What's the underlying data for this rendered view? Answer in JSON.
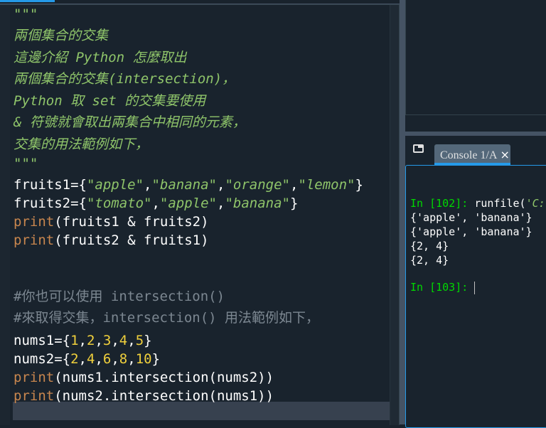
{
  "editor": {
    "lines": [
      [
        {
          "t": "\"\"\"",
          "c": "doc"
        }
      ],
      [
        {
          "t": "兩個集合的交集",
          "c": "doc"
        }
      ],
      [
        {
          "t": "這邊介紹 Python 怎麼取出",
          "c": "doc"
        }
      ],
      [
        {
          "t": "兩個集合的交集(intersection)，",
          "c": "doc"
        }
      ],
      [
        {
          "t": "Python 取 set 的交集要使用",
          "c": "doc"
        }
      ],
      [
        {
          "t": "& 符號就會取出兩集合中相同的元素，",
          "c": "doc"
        }
      ],
      [
        {
          "t": "交集的用法範例如下，",
          "c": "doc"
        }
      ],
      [
        {
          "t": "\"\"\"",
          "c": "doc"
        }
      ],
      [
        {
          "t": "fruits1={",
          "c": "df"
        },
        {
          "t": "\"apple\"",
          "c": "str"
        },
        {
          "t": ",",
          "c": "df"
        },
        {
          "t": "\"banana\"",
          "c": "str"
        },
        {
          "t": ",",
          "c": "df"
        },
        {
          "t": "\"orange\"",
          "c": "str"
        },
        {
          "t": ",",
          "c": "df"
        },
        {
          "t": "\"lemon\"",
          "c": "str"
        },
        {
          "t": "}",
          "c": "df"
        }
      ],
      [
        {
          "t": "fruits2={",
          "c": "df"
        },
        {
          "t": "\"tomato\"",
          "c": "str"
        },
        {
          "t": ",",
          "c": "df"
        },
        {
          "t": "\"apple\"",
          "c": "str"
        },
        {
          "t": ",",
          "c": "df"
        },
        {
          "t": "\"banana\"",
          "c": "str"
        },
        {
          "t": "}",
          "c": "df"
        }
      ],
      [
        {
          "t": "print",
          "c": "kw"
        },
        {
          "t": "(fruits1 & fruits2)",
          "c": "df"
        }
      ],
      [
        {
          "t": "print",
          "c": "kw"
        },
        {
          "t": "(fruits2 & fruits1)",
          "c": "df"
        }
      ],
      [
        {
          "t": "#你也可以使用 intersection()",
          "c": "cm"
        }
      ],
      [
        {
          "t": "#來取得交集，intersection() 用法範例如下，",
          "c": "cm"
        }
      ],
      [
        {
          "t": "nums1={",
          "c": "df"
        },
        {
          "t": "1",
          "c": "num"
        },
        {
          "t": ",",
          "c": "df"
        },
        {
          "t": "2",
          "c": "num"
        },
        {
          "t": ",",
          "c": "df"
        },
        {
          "t": "3",
          "c": "num"
        },
        {
          "t": ",",
          "c": "df"
        },
        {
          "t": "4",
          "c": "num"
        },
        {
          "t": ",",
          "c": "df"
        },
        {
          "t": "5",
          "c": "num"
        },
        {
          "t": "}",
          "c": "df"
        }
      ],
      [
        {
          "t": "nums2={",
          "c": "df"
        },
        {
          "t": "2",
          "c": "num"
        },
        {
          "t": ",",
          "c": "df"
        },
        {
          "t": "4",
          "c": "num"
        },
        {
          "t": ",",
          "c": "df"
        },
        {
          "t": "6",
          "c": "num"
        },
        {
          "t": ",",
          "c": "df"
        },
        {
          "t": "8",
          "c": "num"
        },
        {
          "t": ",",
          "c": "df"
        },
        {
          "t": "10",
          "c": "num"
        },
        {
          "t": "}",
          "c": "df"
        }
      ],
      [
        {
          "t": "print",
          "c": "kw"
        },
        {
          "t": "(nums1.intersection(nums2))",
          "c": "df"
        }
      ],
      [
        {
          "t": "print",
          "c": "kw"
        },
        {
          "t": "(nums2.intersection(nums1))",
          "c": "df"
        }
      ]
    ]
  },
  "console": {
    "tab_label": "Console 1/A",
    "close_icon": "×",
    "prompt1": "In [102]: ",
    "cmd1": "runfile(",
    "cmd1_arg": "'C:",
    "outputs": [
      "{'apple', 'banana'}",
      "{'apple', 'banana'}",
      "{2, 4}",
      "{2, 4}"
    ],
    "prompt2": "In [103]: "
  },
  "colors": {
    "accent": "#259ae9",
    "background": "#19232d",
    "prompt": "#00d800",
    "keyword": "#c8864e",
    "string": "#8fc56a",
    "number": "#f0d03c",
    "comment": "#7c8791"
  }
}
